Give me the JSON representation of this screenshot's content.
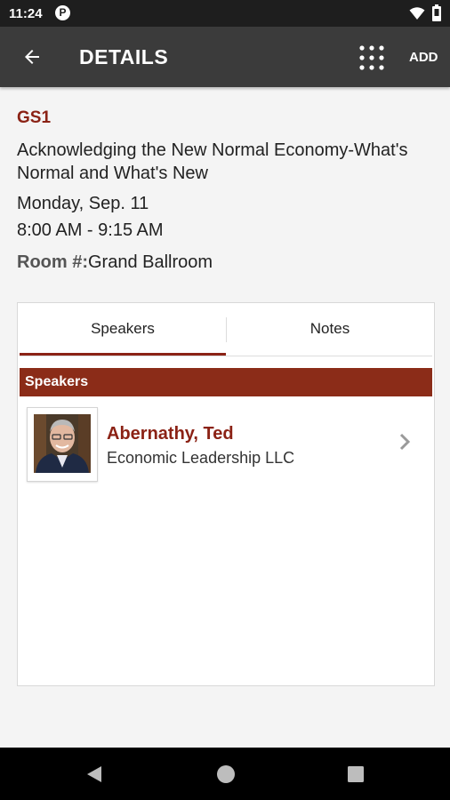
{
  "status_bar": {
    "time": "11:24",
    "app_icon_letter": "P"
  },
  "app_bar": {
    "title": "DETAILS",
    "add_label": "ADD"
  },
  "session": {
    "code": "GS1",
    "title": "Acknowledging the New Normal Economy-What's Normal and What's New",
    "date": "Monday, Sep. 11",
    "time": "8:00 AM - 9:15 AM",
    "room_label": "Room #:",
    "room_value": "Grand Ballroom"
  },
  "tabs": [
    {
      "label": "Speakers",
      "selected": true
    },
    {
      "label": "Notes",
      "selected": false
    }
  ],
  "speakers_section": {
    "header": "Speakers",
    "items": [
      {
        "name": "Abernathy, Ted",
        "organization": "Economic Leadership LLC"
      }
    ]
  },
  "colors": {
    "accent": "#8b2215",
    "section_header": "#8b2c18",
    "app_bar": "#3b3b3b",
    "status_bar": "#1e1e1e"
  }
}
